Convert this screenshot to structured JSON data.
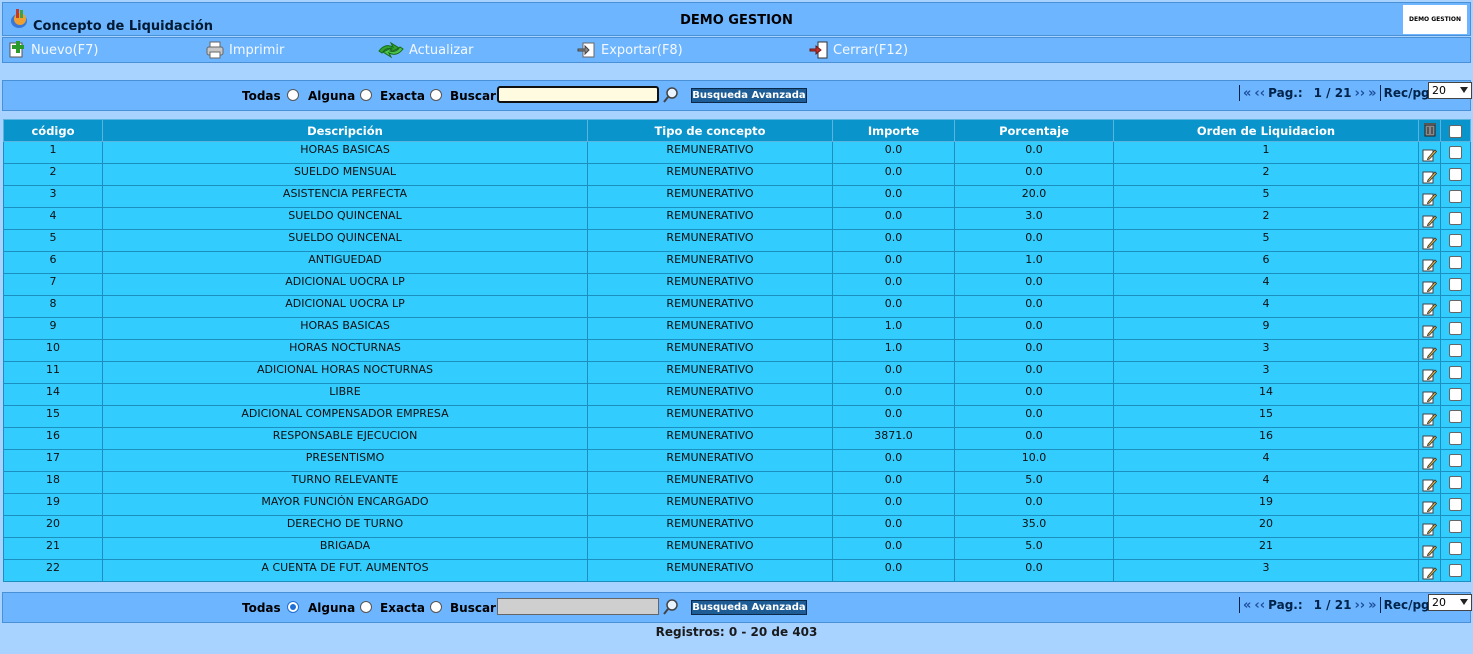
{
  "header": {
    "title": "Concepto de Liquidación",
    "company": "DEMO GESTION",
    "logo_text": "DEMO GESTION"
  },
  "toolbar": {
    "nuevo": "Nuevo(F7)",
    "imprimir": "Imprimir",
    "actualizar": "Actualizar",
    "exportar": "Exportar(F8)",
    "cerrar": "Cerrar(F12)"
  },
  "search": {
    "todas": "Todas",
    "alguna": "Alguna",
    "exacta": "Exacta",
    "buscar": "Buscar",
    "value": "",
    "advanced": "Busqueda Avanzada"
  },
  "pager": {
    "label": "Pag.:",
    "current": "1 / 21",
    "rec_label": "Rec/pg:",
    "rec_value": "20"
  },
  "table": {
    "columns": [
      "código",
      "Descripción",
      "Tipo de concepto",
      "Importe",
      "Porcentaje",
      "Orden de Liquidacion"
    ],
    "rows": [
      [
        "1",
        "HORAS BASICAS",
        "REMUNERATIVO",
        "0.0",
        "0.0",
        "1"
      ],
      [
        "2",
        "SUELDO MENSUAL",
        "REMUNERATIVO",
        "0.0",
        "0.0",
        "2"
      ],
      [
        "3",
        "ASISTENCIA PERFECTA",
        "REMUNERATIVO",
        "0.0",
        "20.0",
        "5"
      ],
      [
        "4",
        "SUELDO QUINCENAL",
        "REMUNERATIVO",
        "0.0",
        "3.0",
        "2"
      ],
      [
        "5",
        "SUELDO QUINCENAL",
        "REMUNERATIVO",
        "0.0",
        "0.0",
        "5"
      ],
      [
        "6",
        "ANTIGUEDAD",
        "REMUNERATIVO",
        "0.0",
        "1.0",
        "6"
      ],
      [
        "7",
        "ADICIONAL UOCRA LP",
        "REMUNERATIVO",
        "0.0",
        "0.0",
        "4"
      ],
      [
        "8",
        "ADICIONAL UOCRA LP",
        "REMUNERATIVO",
        "0.0",
        "0.0",
        "4"
      ],
      [
        "9",
        "HORAS BASICAS",
        "REMUNERATIVO",
        "1.0",
        "0.0",
        "9"
      ],
      [
        "10",
        "HORAS NOCTURNAS",
        "REMUNERATIVO",
        "1.0",
        "0.0",
        "3"
      ],
      [
        "11",
        "ADICIONAL HORAS NOCTURNAS",
        "REMUNERATIVO",
        "0.0",
        "0.0",
        "3"
      ],
      [
        "14",
        "LIBRE",
        "REMUNERATIVO",
        "0.0",
        "0.0",
        "14"
      ],
      [
        "15",
        "ADICIONAL COMPENSADOR EMPRESA",
        "REMUNERATIVO",
        "0.0",
        "0.0",
        "15"
      ],
      [
        "16",
        "RESPONSABLE EJECUCION",
        "REMUNERATIVO",
        "3871.0",
        "0.0",
        "16"
      ],
      [
        "17",
        "PRESENTISMO",
        "REMUNERATIVO",
        "0.0",
        "10.0",
        "4"
      ],
      [
        "18",
        "TURNO RELEVANTE",
        "REMUNERATIVO",
        "0.0",
        "5.0",
        "4"
      ],
      [
        "19",
        "MAYOR FUNCIÓN ENCARGADO",
        "REMUNERATIVO",
        "0.0",
        "0.0",
        "19"
      ],
      [
        "20",
        "DERECHO DE TURNO",
        "REMUNERATIVO",
        "0.0",
        "35.0",
        "20"
      ],
      [
        "21",
        "BRIGADA",
        "REMUNERATIVO",
        "0.0",
        "5.0",
        "21"
      ],
      [
        "22",
        "A CUENTA DE FUT. AUMENTOS",
        "REMUNERATIVO",
        "0.0",
        "0.0",
        "3"
      ]
    ]
  },
  "footer": {
    "registros": "Registros: 0 - 20 de 403"
  }
}
